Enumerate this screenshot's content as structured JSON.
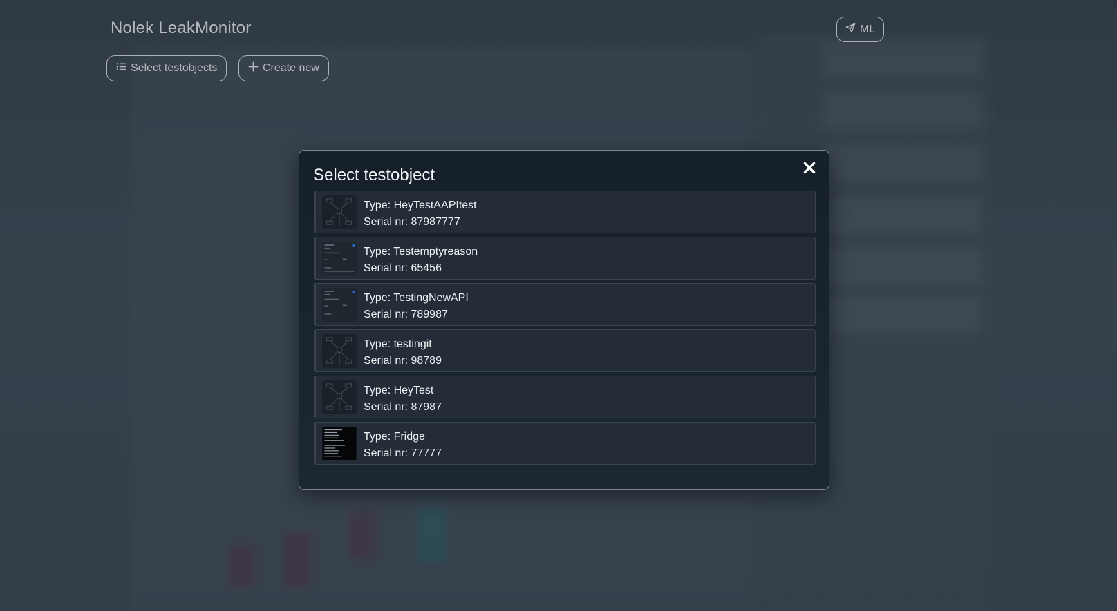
{
  "app": {
    "title": "Nolek LeakMonitor"
  },
  "toolbar": {
    "select_label": "Select testobjects",
    "create_label": "Create new",
    "ml_label": "ML"
  },
  "modal": {
    "title": "Select testobject",
    "items": [
      {
        "type": "Type: HeyTestAAPItest",
        "serial": "Serial nr: 87987777",
        "thumb": "diagram-thumbnail"
      },
      {
        "type": "Type: Testemptyreason",
        "serial": "Serial nr: 65456",
        "thumb": "screenshot-thumbnail"
      },
      {
        "type": "Type: TestingNewAPI",
        "serial": "Serial nr: 789987",
        "thumb": "screenshot-thumbnail"
      },
      {
        "type": "Type: testingit",
        "serial": "Serial nr: 98789",
        "thumb": "diagram-thumbnail"
      },
      {
        "type": "Type: HeyTest",
        "serial": "Serial nr: 87987",
        "thumb": "diagram-thumbnail"
      },
      {
        "type": "Type: Fridge",
        "serial": "Serial nr: 77777",
        "thumb": "terminal-thumbnail"
      }
    ]
  },
  "icons": {
    "select": "list-icon",
    "create": "plus-icon",
    "ml": "send-icon",
    "close": "close-icon"
  },
  "colors": {
    "background": "#3e4a56",
    "modal": "#18222c",
    "item": "#242d37",
    "text": "#f2f4f6"
  }
}
